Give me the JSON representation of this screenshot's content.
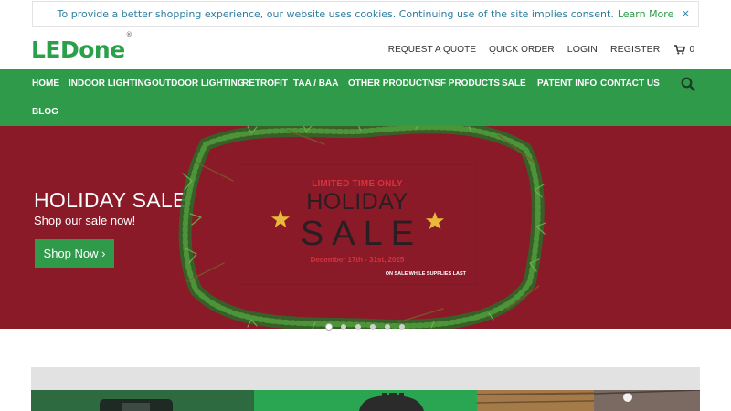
{
  "cookie": {
    "message": "To provide a better shopping experience, our website uses cookies. Continuing use of the site implies consent.",
    "link_label": "Learn More",
    "close_label": "×"
  },
  "header": {
    "logo": "LEDone",
    "logo_mark": "®",
    "links": [
      "REQUEST A QUOTE",
      "QUICK ORDER",
      "LOGIN",
      "REGISTER"
    ],
    "cart_count": "0"
  },
  "nav": {
    "items": [
      "HOME",
      "INDOOR LIGHTING",
      "OUTDOOR LIGHTING",
      "RETROFIT",
      "TAA / BAA",
      "OTHER PRODUCT",
      "NSF PRODUCTS",
      "SALE",
      "PATENT INFO",
      "CONTACT US",
      "BLOG"
    ]
  },
  "hero": {
    "title": "HOLIDAY SALE",
    "subtitle": "Shop our sale now!",
    "button_label": "Shop Now ›",
    "card": {
      "top_line": "LIMITED TIME ONLY",
      "word1": "HOLIDAY",
      "word2": "SALE",
      "dates": "December 17th - 31st, 2025",
      "note": "ON SALE WHILE SUPPLIES LAST"
    },
    "slide_count": 6,
    "active_slide": 1
  },
  "colors": {
    "brand_green": "#2e9a4a",
    "hero_red": "#8a1a28",
    "cookie_text": "#2b7ea0"
  },
  "icons": [
    "close-icon",
    "cart-icon",
    "search-icon",
    "star-icon",
    "chevron-right-icon"
  ]
}
